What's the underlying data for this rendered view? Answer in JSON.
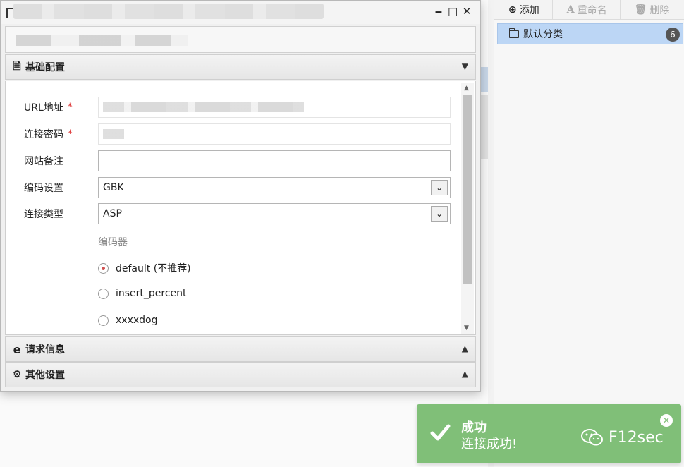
{
  "right_panel": {
    "toolbar": {
      "add_label": "添加",
      "rename_label": "重命名",
      "delete_label": "删除"
    },
    "categories": [
      {
        "label": "默认分类",
        "count": "6"
      }
    ]
  },
  "dialog": {
    "sections": {
      "basic": "基础配置",
      "request": "请求信息",
      "other": "其他设置"
    },
    "form": {
      "url_label": "URL地址",
      "password_label": "连接密码",
      "note_label": "网站备注",
      "note_value": "",
      "encoding_label": "编码设置",
      "encoding_value": "GBK",
      "type_label": "连接类型",
      "type_value": "ASP",
      "required_mark": "*"
    },
    "encoder": {
      "label": "编码器",
      "options": [
        {
          "label": "default (不推荐)",
          "checked": true
        },
        {
          "label": "insert_percent",
          "checked": false
        },
        {
          "label": "xxxxdog",
          "checked": false
        }
      ]
    }
  },
  "toast": {
    "title": "成功",
    "message": "连接成功!",
    "watermark": "F12sec",
    "color": "#80bf78"
  }
}
